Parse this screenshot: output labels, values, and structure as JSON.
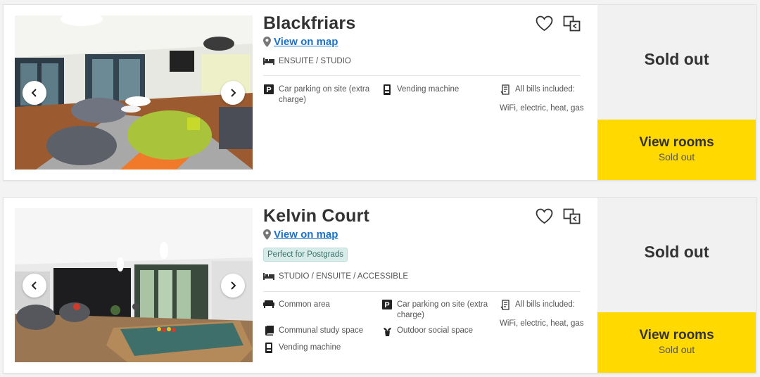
{
  "colors": {
    "accent_yellow": "#ffd900",
    "link_blue": "#1a73c8",
    "badge_bg": "#d7ece9",
    "status_bg": "#f1f1f1"
  },
  "listings": [
    {
      "name": "Blackfriars",
      "map_link": "View on map",
      "room_types": "ENSUITE / STUDIO",
      "amenities": [
        {
          "icon": "parking-icon",
          "label": "Car parking on site (extra charge)"
        },
        {
          "icon": "vending-machine-icon",
          "label": "Vending machine"
        },
        {
          "icon": "bills-icon",
          "label": "All bills included:"
        }
      ],
      "bills_detail": "WiFi, electric, heat, gas",
      "status": "Sold out",
      "cta_label": "View rooms",
      "cta_sub": "Sold out"
    },
    {
      "name": "Kelvin Court",
      "map_link": "View on map",
      "badge": "Perfect for Postgrads",
      "room_types": "STUDIO / ENSUITE / ACCESSIBLE",
      "amenities": [
        {
          "icon": "sofa-icon",
          "label": "Common area"
        },
        {
          "icon": "parking-icon",
          "label": "Car parking on site (extra charge)"
        },
        {
          "icon": "bills-icon",
          "label": "All bills included:"
        },
        {
          "icon": "book-icon",
          "label": "Communal study space"
        },
        {
          "icon": "plant-icon",
          "label": "Outdoor social space"
        },
        {
          "icon": "vending-machine-icon",
          "label": "Vending machine"
        }
      ],
      "bills_detail": "WiFi, electric, heat, gas",
      "status": "Sold out",
      "cta_label": "View rooms",
      "cta_sub": "Sold out"
    }
  ]
}
